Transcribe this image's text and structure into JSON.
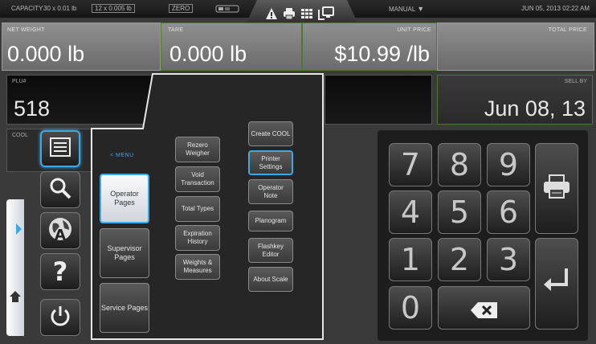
{
  "topbar": {
    "capacity_label": "CAPACITY",
    "capacity_1": "30 x 0.01 lb",
    "capacity_2": "12 x 0.005 lb",
    "zero": "ZERO",
    "mode": "MANUAL",
    "datetime": "JUN 05, 2013 02:22 AM"
  },
  "displays": {
    "net_weight": {
      "label": "NET WEIGHT",
      "value": "0.000 lb"
    },
    "tare": {
      "label": "TARE",
      "value": "0.000 lb"
    },
    "unit_price": {
      "label": "UNIT PRICE",
      "value": "$10.99 /lb"
    },
    "total_price": {
      "label": "TOTAL PRICE",
      "value": ""
    },
    "plu": {
      "label": "PLU#",
      "value": "518"
    },
    "sell_by": {
      "label": "SELL BY",
      "value": "Jun 08, 13"
    },
    "cool": {
      "label": "COOL"
    }
  },
  "menu": {
    "back_label": "< MENU",
    "pages": [
      {
        "label": "Operator Pages",
        "active": true
      },
      {
        "label": "Supervisor Pages",
        "active": false
      },
      {
        "label": "Service Pages",
        "active": false
      }
    ],
    "col1": [
      "Rezero Weigher",
      "Void Transaction",
      "Total Types",
      "Expiration History",
      "Weights & Measures"
    ],
    "col2": [
      "Create COOL",
      "Printer Settings",
      "Operator Note",
      "Planogram",
      "Flashkey Editor",
      "About Scale"
    ]
  },
  "keypad": {
    "keys": [
      "7",
      "8",
      "9",
      "4",
      "5",
      "6",
      "1",
      "2",
      "3",
      "0"
    ]
  },
  "colors": {
    "accent": "#3fa9e6",
    "panel_gray": "#7d7d7d",
    "highlight_green": "#4a7a2a"
  }
}
